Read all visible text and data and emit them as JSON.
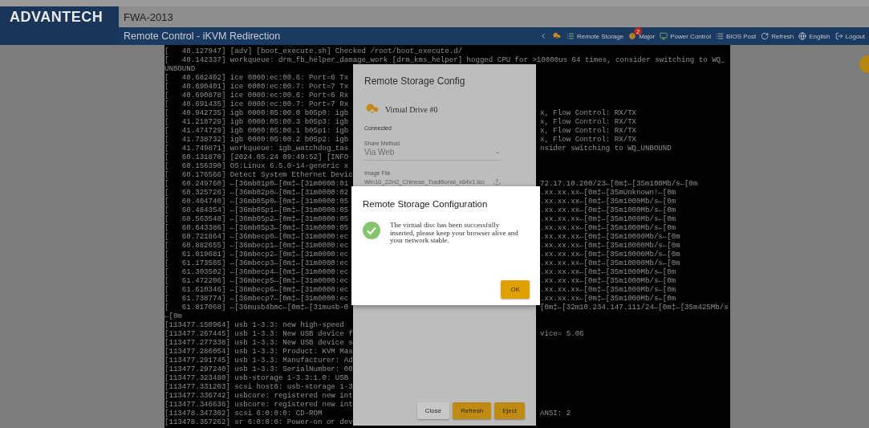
{
  "header": {
    "logo": "ADVANTECH",
    "device": "FWA-2013",
    "page_title": "Remote Control - iKVM Redirection",
    "toolbar": [
      {
        "label": "Remote Storage"
      },
      {
        "label": "Major",
        "badge": "2"
      },
      {
        "label": "Power Control"
      },
      {
        "label": "BIOS Post"
      },
      {
        "label": "Refresh"
      },
      {
        "label": "English"
      },
      {
        "label": "Logout"
      }
    ]
  },
  "terminal": {
    "lines": [
      {
        "kind": "full",
        "left": "[   40.127947] [adv] [boot_execute.sh] Checked /root/boot_execute.d/"
      },
      {
        "kind": "full",
        "left": "[   40.142337] workqueue: drm_fb_helper_damage_work [drm_kms_helper] hogged CPU for >10000us 64 times, consider switching to WQ_"
      },
      {
        "kind": "full",
        "left": "UNBOUND"
      },
      {
        "kind": "split",
        "left": "[   40.682402] ice 0000:ec:00.6: Port=6 Tx"
      },
      {
        "kind": "split",
        "left": "[   40.690401] ice 0000:ec:00.7: Port=7 Tx"
      },
      {
        "kind": "split",
        "left": "[   40.690878] ice 0000:ec:00.6: Port=6 Rx"
      },
      {
        "kind": "split",
        "left": "[   40.691435] ice 0000:ec:00.7: Port=7 Rx"
      },
      {
        "kind": "split",
        "left": "[   40.942735] igb 0000:05:00.0 b05p0: igb",
        "right": "x, Flow Control: RX/TX"
      },
      {
        "kind": "split",
        "left": "[   41.218729] igb 0000:05:00.3 b05p3: igb",
        "right": "x, Flow Control: RX/TX"
      },
      {
        "kind": "split",
        "left": "[   41.474729] igb 0000:05:00.1 b05p1: igb",
        "right": "x, Flow Control: RX/TX"
      },
      {
        "kind": "split",
        "left": "[   41.738732] igb 0000:05:00.2 b05p2: igb",
        "right": "x, Flow Control: RX/TX"
      },
      {
        "kind": "split",
        "left": "[   41.749871] workqueue: igb_watchdog_tas",
        "right": "nsider switching to WQ_UNBOUND"
      },
      {
        "kind": "split",
        "left": "[   60.131870] [2024.05.24 09:49:52] [INFO"
      },
      {
        "kind": "split",
        "left": "[   60.156390] OS:Linux 6.5.0-14-generic x"
      },
      {
        "kind": "split",
        "left": "[   60.176566] Detect System Ethernet Devic"
      },
      {
        "kind": "split",
        "left": "[   60.249760] ←[36mb01p0←[0m‡←[31m0000:01",
        "right": "72.17.10.200/23←[0m‡←[35m100Mb/s←[0m"
      },
      {
        "kind": "split",
        "left": "[   60.325726] ←[36mb02p0←[0m‡←[31m0000:02",
        "right": ".xx.xx.xx←[0m‡←[35mUnknown!←[0m"
      },
      {
        "kind": "split",
        "left": "[   60.404740] ←[36mb05p0←[0m‡←[31m0000:05",
        "right": ".xx.xx.xx←[0m‡←[35m1000Mb/s←[0m"
      },
      {
        "kind": "split",
        "left": "[   60.484354] ←[36mb05p1←[0m‡←[31m0000:05",
        "right": ".xx.xx.xx←[0m‡←[35m1000Mb/s←[0m"
      },
      {
        "kind": "split",
        "left": "[   60.563548] ←[36mb05p2←[0m‡←[31m0000:05",
        "right": ".xx.xx.xx←[0m‡←[35m1000Mb/s←[0m"
      },
      {
        "kind": "split",
        "left": "[   60.643386] ←[36mb05p3←[0m‡←[31m0000:05",
        "right": ".xx.xx.xx←[0m‡←[35m1000Mb/s←[0m"
      },
      {
        "kind": "split",
        "left": "[   60.721864] ←[36mbecp0←[0m‡←[31m0000:ec",
        "right": ".xx.xx.xx←[0m‡←[35m10000Mb/s←[0m"
      },
      {
        "kind": "split",
        "left": "[   60.882655] ←[36mbecp1←[0m‡←[31m0000:ec",
        "right": ".xx.xx.xx←[0m‡←[35m10000Mb/s←[0m"
      },
      {
        "kind": "split",
        "left": "[   61.019681] ←[36mbecp2←[0m‡←[31m0000:ec",
        "right": ".xx.xx.xx←[0m‡←[35m10000Mb/s←[0m"
      },
      {
        "kind": "split",
        "left": "[   61.173565] ←[36mbecp3←[0m‡←[31m0000:ec",
        "right": ".xx.xx.xx←[0m‡←[35m10000Mb/s←[0m"
      },
      {
        "kind": "split",
        "left": "[   61.303502] ←[36mbecp4←[0m‡←[31m0000:ec",
        "right": ".xx.xx.xx←[0m‡←[35m1000Mb/s←[0m"
      },
      {
        "kind": "split",
        "left": "[   61.472206] ←[36mbecp5←[0m‡←[31m0000:ec",
        "right": ".xx.xx.xx←[0m‡←[35m1000Mb/s←[0m"
      },
      {
        "kind": "split",
        "left": "[   61.610346] ←[36mbecp6←[0m‡←[31m0000:ec",
        "right": ".xx.xx.xx←[0m‡←[35m1000Mb/s←[0m"
      },
      {
        "kind": "split",
        "left": "[   61.738774] ←[36mbecp7←[0m‡←[31m0000:ec",
        "right": ".xx.xx.xx←[0m‡←[35m1000Mb/s←[0m"
      },
      {
        "kind": "split",
        "left": "[   61.817068] ←[36musb4bmc←[0m‡←[31musb-0",
        "right": "[0m‡←[32m10.234.147.111/24←[0m‡←[35m425Mb/s"
      },
      {
        "kind": "split",
        "left": "←[0m"
      },
      {
        "kind": "split",
        "left": "[113477.150964] usb 1-3.3: new high-speed"
      },
      {
        "kind": "split",
        "left": "[113477.267445] usb 1-3.3: New USB device f",
        "right": "vice= 5.06"
      },
      {
        "kind": "split",
        "left": "[113477.277338] usb 1-3.3: New USB device s"
      },
      {
        "kind": "split",
        "left": "[113477.286054] usb 1-3.3: Product: KVM Mas"
      },
      {
        "kind": "split",
        "left": "[113477.291745] usb 1-3.3: Manufacturer: Ad"
      },
      {
        "kind": "split",
        "left": "[113477.297240] usb 1-3.3: SerialNumber: 00"
      },
      {
        "kind": "split",
        "left": "[113477.323480] usb-storage 1-3.3:1.0: USB"
      },
      {
        "kind": "split",
        "left": "[113477.331203] scsi host6: usb-storage 1-3"
      },
      {
        "kind": "split",
        "left": "[113477.336742] usbcore: registered new int"
      },
      {
        "kind": "split",
        "left": "[113477.346636] usbcore: registered new int"
      },
      {
        "kind": "split",
        "left": "[113478.347302] scsi 6:0:0:0: CD-ROM",
        "right": "ANSI: 2"
      },
      {
        "kind": "split",
        "left": "[113478.357262] sr 6:0:0:0: Power-on or dev"
      }
    ]
  },
  "storage_dialog": {
    "title": "Remote Storage Config",
    "drive": "Virtual Drive #0",
    "status": "Connected",
    "share_method": {
      "label": "Share Method",
      "value": "Via Web"
    },
    "image_file": {
      "label": "Image File",
      "value": "Win10_22H2_Chinese_Traditional_x64v1.iso"
    },
    "buttons": [
      {
        "label": "Close",
        "kind": "secondary"
      },
      {
        "label": "Refresh",
        "kind": "primary"
      },
      {
        "label": "Eject",
        "kind": "primary"
      }
    ]
  },
  "alert_dialog": {
    "title": "Remote Storage Configuration",
    "message": "The virtual disc has been successfully inserted, please keep your browser alive and your network stable.",
    "button": "OK"
  }
}
